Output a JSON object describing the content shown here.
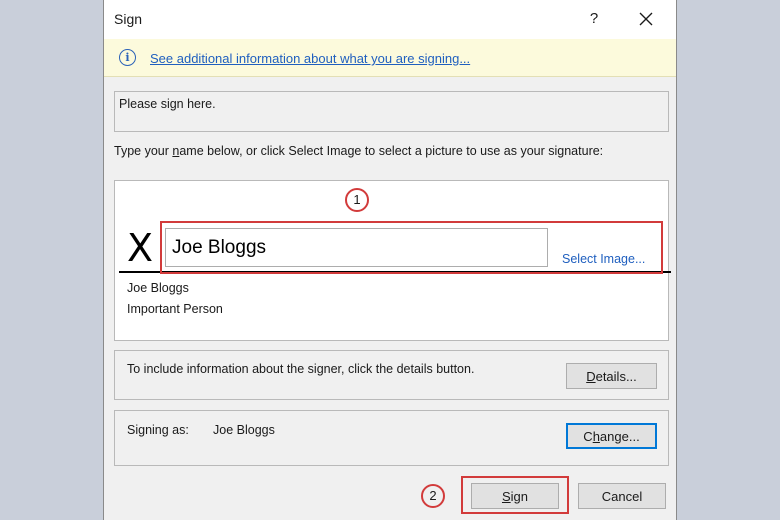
{
  "dialog": {
    "title": "Sign",
    "help_label": "?",
    "info_link": "See additional information about what you are signing...",
    "purpose_text": "Please sign here.",
    "instruction": "Type your name below, or click Select Image to select a picture to use as your signature:",
    "signature": {
      "x_mark": "X",
      "typed_name": "Joe Bloggs",
      "select_image": "Select Image...",
      "signer_name": "Joe Bloggs",
      "signer_title": "Important Person"
    },
    "details": {
      "text": "To include information about the signer, click the details button.",
      "button": "Details..."
    },
    "signing_as": {
      "label": "Signing as:",
      "name": "Joe Bloggs",
      "change_button": "Change..."
    },
    "buttons": {
      "sign": "Sign",
      "cancel": "Cancel"
    }
  },
  "annotations": {
    "step1": "1",
    "step2": "2"
  },
  "icons": {
    "info": "info-icon",
    "close": "close-icon"
  },
  "colors": {
    "highlight": "#d23b3b",
    "link": "#1f5fbf",
    "infobar_bg": "#fcfadc",
    "focus": "#0078d7"
  }
}
